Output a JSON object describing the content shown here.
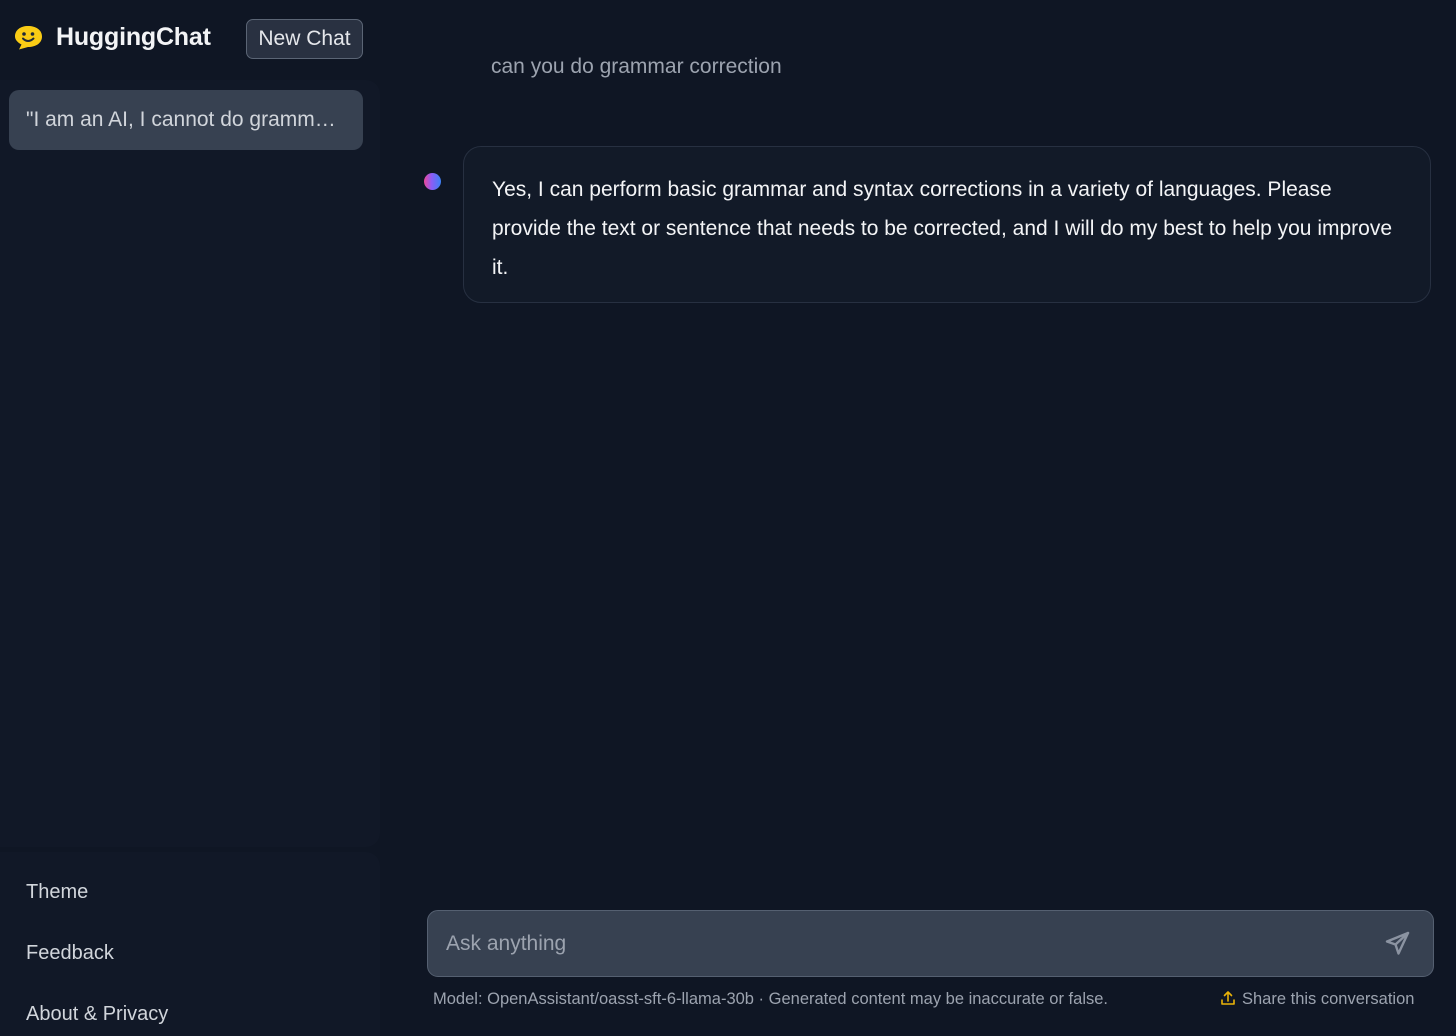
{
  "app": {
    "brand": "HuggingChat",
    "logo_icon": "hugging-face-emoji-icon",
    "new_chat_label": "New Chat"
  },
  "sidebar": {
    "conversations": [
      {
        "title": "\"I am an AI, I cannot do grammar correction\""
      }
    ],
    "bottom_links": [
      "Theme",
      "Feedback",
      "About & Privacy"
    ]
  },
  "messages": [
    {
      "role": "user",
      "text": "can you do grammar correction"
    },
    {
      "role": "assistant",
      "text": "Yes, I can perform basic grammar and syntax corrections in a variety of languages. Please provide the text or sentence that needs to be corrected, and I will do my best to help you improve it."
    }
  ],
  "input": {
    "placeholder": "Ask anything",
    "send_icon": "send-icon"
  },
  "footer": {
    "model_note": "Model: OpenAssistant/oasst-sft-6-llama-30b · Generated content may be inaccurate or false.",
    "share_label": "Share this conversation",
    "share_icon": "share-icon"
  },
  "colors": {
    "background": "#0f1624",
    "panel": "#111827",
    "active_item": "#374151",
    "accent_yellow": "#facc15"
  }
}
